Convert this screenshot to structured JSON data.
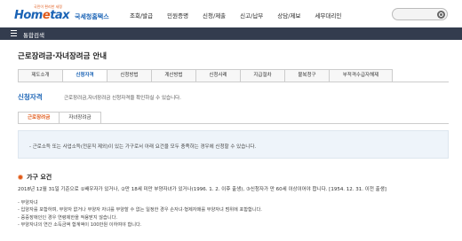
{
  "header": {
    "logo_small": "국민이 편리한 세정",
    "logo_brand_a": "Hom",
    "logo_brand_e": "e",
    "logo_brand_b": "tax",
    "logo_sub": "국세청홈택스",
    "nav": [
      "조회/발급",
      "민원증명",
      "신청/제출",
      "신고/납부",
      "상담/제보",
      "세무대리인"
    ],
    "search_placeholder": ""
  },
  "bar": {
    "title": "통합검색"
  },
  "page_title": "근로장려금·자녀장려금 안내",
  "tabs": [
    "제도소개",
    "신청자격",
    "신청방법",
    "계산방법",
    "신청사례",
    "지급절차",
    "불복청구",
    "부적격수급자해제"
  ],
  "active_tab": 1,
  "section": {
    "title": "신청자격",
    "desc": "근로장려금,자녀장려금 신청자격을 확인하실 수 있습니다."
  },
  "subtabs": [
    "근로장려금",
    "자녀장려금"
  ],
  "active_subtab": 0,
  "infobox": "- 근로소득 또는 사업소득(전문직 제외)이 있는 가구로서 아래 요건을 모두 충족하는 경우에 신청할 수 있습니다.",
  "household": {
    "title": "가구 요건",
    "para": "2018년 12월 31일 기준으로 ①배우자가 있거나, ②만 18세 미만 부양자녀가 있거나(1996. 1. 2. 이후 출생), ③신청자가 만 60세 이상이어야 합니다. [1954. 12. 31. 이전 출생]",
    "items": [
      "- 부양자녀",
      "- 입양자를 포함하며, 부양자 없거나 부양자 자녀를 부양할 수 없는 일정한 경우 손자녀·형제자매를 부양자녀 범위에 포함합니다.",
      "- 중증장애인인 경우 연령제한을 적용받지 않습니다.",
      "- 부양자녀의 연간 소득금액 합계액이 100만원 이하여야 합니다."
    ]
  },
  "colors": {
    "brand_blue": "#1a63b5",
    "accent_orange": "#e05a1a",
    "bar_dark": "#333c4e"
  }
}
